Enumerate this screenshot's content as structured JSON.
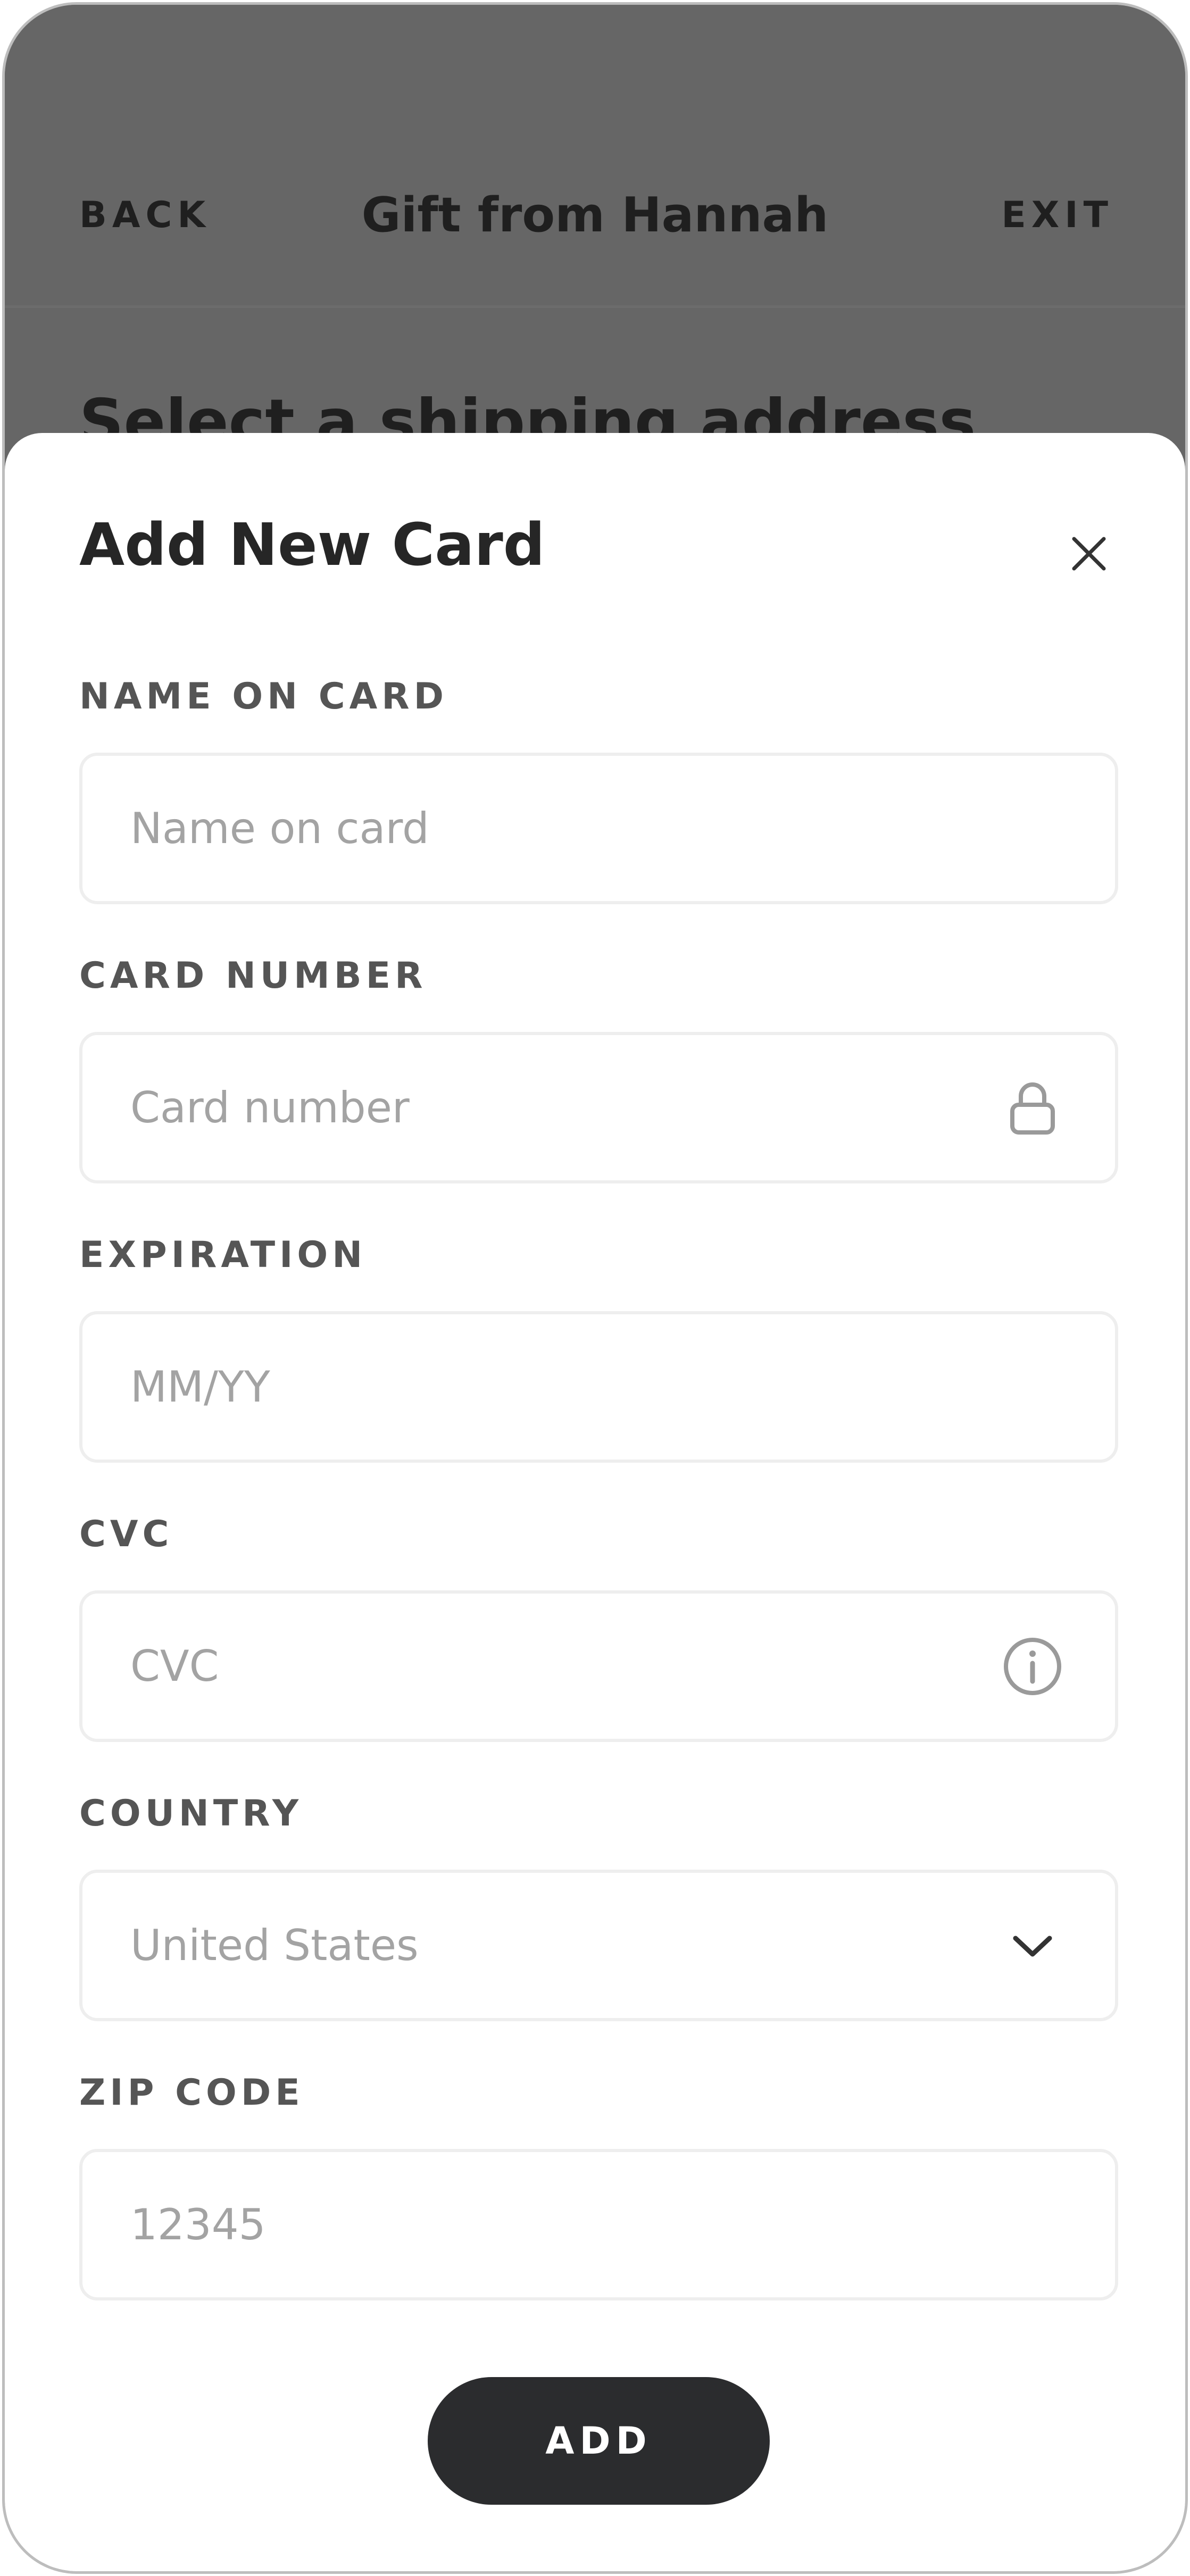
{
  "header": {
    "back_label": "BACK",
    "title": "Gift from Hannah",
    "exit_label": "EXIT"
  },
  "background": {
    "heading": "Select a shipping address"
  },
  "sheet": {
    "title": "Add New Card",
    "fields": {
      "name": {
        "label": "NAME ON CARD",
        "placeholder": "Name on card",
        "value": ""
      },
      "card_number": {
        "label": "CARD NUMBER",
        "placeholder": "Card number",
        "value": "",
        "icon": "lock-icon"
      },
      "expiration": {
        "label": "EXPIRATION",
        "placeholder": "MM/YY",
        "value": ""
      },
      "cvc": {
        "label": "CVC",
        "placeholder": "CVC",
        "value": "",
        "icon": "info-icon"
      },
      "country": {
        "label": "COUNTRY",
        "value": "United States",
        "icon": "chevron-down-icon"
      },
      "zip": {
        "label": "ZIP CODE",
        "placeholder": "12345",
        "value": ""
      }
    },
    "add_label": "ADD"
  },
  "colors": {
    "overlay": "#666666",
    "button_bg": "#2b2c2e",
    "placeholder": "#a3a3a3",
    "label": "#555555"
  }
}
